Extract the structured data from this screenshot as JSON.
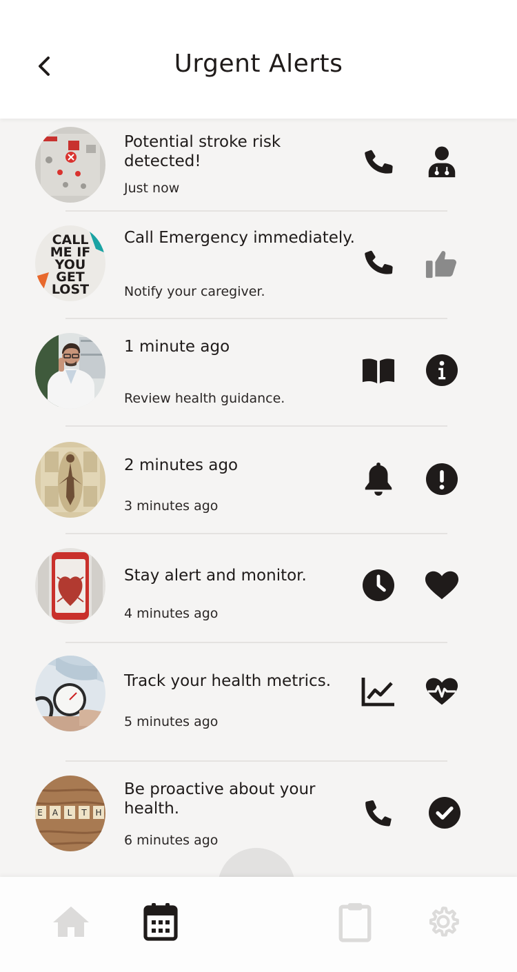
{
  "header": {
    "title": "Urgent Alerts",
    "back_icon": "chevron-left-icon"
  },
  "alerts": [
    {
      "message": "Potential stroke risk detected!",
      "subtext": "Just now",
      "image": "emergency-panel-photo",
      "actions": [
        "phone-icon",
        "doctor-icon"
      ]
    },
    {
      "message": "Call Emergency immediately.",
      "subtext": "Notify your caregiver.",
      "image": "call-me-if-you-get-lost-sign",
      "image_text": "CALL ME IF YOU GET LOST",
      "actions": [
        "phone-icon",
        "thumbs-up-icon"
      ]
    },
    {
      "message": "1 minute ago",
      "subtext": "Review health guidance.",
      "image": "doctor-on-phone-photo",
      "actions": [
        "book-icon",
        "info-icon"
      ]
    },
    {
      "message": "2 minutes ago",
      "subtext": "3 minutes ago",
      "image": "anatomy-chart-photo",
      "actions": [
        "bell-icon",
        "exclamation-icon"
      ]
    },
    {
      "message": "Stay alert and monitor.",
      "subtext": "4 minutes ago",
      "image": "heart-on-phone-photo",
      "actions": [
        "clock-icon",
        "heart-icon"
      ]
    },
    {
      "message": "Track your health metrics.",
      "subtext": "5 minutes ago",
      "image": "blood-pressure-gauge-photo",
      "actions": [
        "line-chart-icon",
        "heartbeat-icon"
      ]
    },
    {
      "message": "Be proactive about your health.",
      "subtext": "6 minutes ago",
      "image": "health-scrabble-tiles-photo",
      "image_text": [
        "E",
        "A",
        "L",
        "T",
        "H"
      ],
      "actions": [
        "phone-icon",
        "check-circle-icon"
      ]
    }
  ],
  "tabbar": {
    "items": [
      {
        "name": "home",
        "icon": "home-icon",
        "active": false
      },
      {
        "name": "calendar",
        "icon": "calendar-icon",
        "active": true
      },
      {
        "name": "clipboard",
        "icon": "clipboard-icon",
        "active": false
      },
      {
        "name": "settings",
        "icon": "gear-icon",
        "active": false
      }
    ]
  },
  "colors": {
    "ink": "#1f1b1a",
    "inactive": "#dcdbda",
    "background": "#f5f4f3",
    "thumbs_up": "#8a8a8a"
  }
}
